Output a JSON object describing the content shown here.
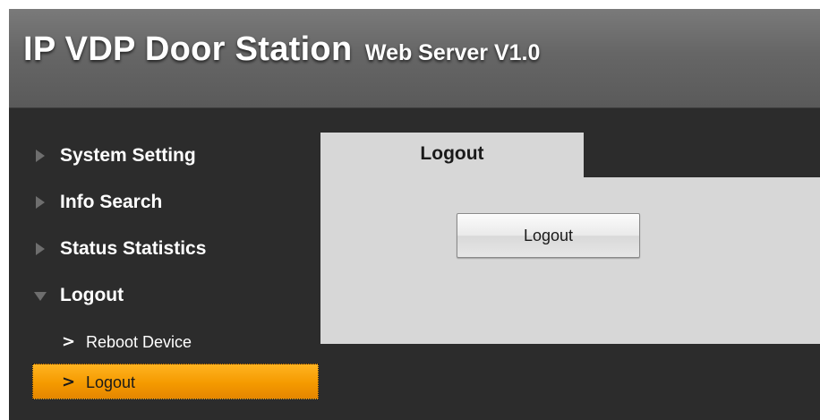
{
  "header": {
    "title": "IP VDP Door Station",
    "subtitle": "Web Server V1.0"
  },
  "sidebar": {
    "items": [
      {
        "label": "System Setting",
        "icon": "triangle-right-icon",
        "expanded": false
      },
      {
        "label": "Info Search",
        "icon": "triangle-right-icon",
        "expanded": false
      },
      {
        "label": "Status Statistics",
        "icon": "triangle-right-icon",
        "expanded": false
      },
      {
        "label": "Logout",
        "icon": "triangle-down-icon",
        "expanded": true
      }
    ],
    "sub_items": [
      {
        "label": "Reboot Device",
        "icon": "chevron-right-icon",
        "active": false
      },
      {
        "label": "Logout",
        "icon": "chevron-right-icon",
        "active": true
      }
    ],
    "chevron": ">"
  },
  "main": {
    "tab_label": "Logout",
    "button_label": "Logout"
  },
  "colors": {
    "header_bg": "#666666",
    "page_bg": "#2c2c2c",
    "content_bg": "#d7d7d7",
    "active_accent": "#f59a00",
    "text_light": "#ffffff",
    "text_dark": "#1a1a1a"
  }
}
